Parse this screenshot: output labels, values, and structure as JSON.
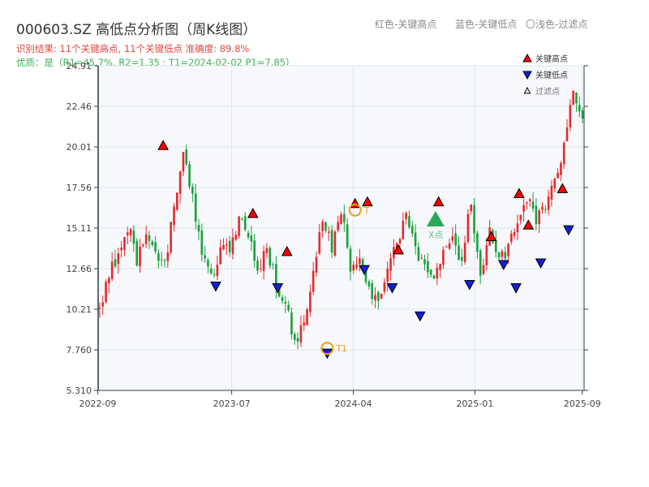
{
  "header": {
    "title": "000603.SZ 高低点分析图（周K线图）",
    "result_line": "识别结果: 11个关键高点, 11个关键低点  准确度: 89.8%",
    "quality_line": "优质：是（R1=45.7%, R2=1.35 ; T1=2024-02-02 P1=7.85）",
    "hint_red": "红色-关键高点",
    "hint_blue": "蓝色-关键低点",
    "hint_light": "〇浅色-过滤点"
  },
  "colors": {
    "up": "#e8282d",
    "down": "#1aa03c",
    "high_marker": "#ff0000",
    "low_marker": "#1020d8",
    "big_marker": "#2aa85a",
    "ring": "#f39c12",
    "plot_bg": "#f6f8fb",
    "grid": "#e2e6ea",
    "axis": "#2f3e50"
  },
  "chart_data": {
    "type": "candlestick",
    "title": "000603.SZ 高低点分析图（周K线图）",
    "x_range": [
      "2022-09-02",
      "2025-09-05"
    ],
    "ylim": [
      5.31,
      24.91
    ],
    "y_ticks": [
      "5.310",
      "7.760",
      "10.21",
      "12.66",
      "15.11",
      "17.56",
      "20.01",
      "22.46",
      "24.91"
    ],
    "x_ticks": [
      {
        "label": "2022-09",
        "date": "2022-09-01"
      },
      {
        "label": "2023-07",
        "date": "2023-07-01"
      },
      {
        "label": "2024-04",
        "date": "2024-04-01"
      },
      {
        "label": "2025-01",
        "date": "2025-01-01"
      },
      {
        "label": "2025-09",
        "date": "2025-09-01"
      }
    ],
    "legend": {
      "placement": "top-right",
      "entries": [
        {
          "label": "关键高点",
          "symbol": "up-triangle",
          "color": "#ff0000"
        },
        {
          "label": "关键低点",
          "symbol": "down-triangle",
          "color": "#1020d8"
        },
        {
          "label": "过滤点",
          "symbol": "small-up-triangle",
          "color": "#ffffff"
        }
      ]
    },
    "key_points": [
      {
        "value": 10.0
      },
      {
        "value": 12.4
      },
      {
        "value": 13.2
      },
      {
        "value": 15.3
      },
      {
        "value": 13.3
      },
      {
        "value": 14.6
      },
      {
        "value": 13.5
      },
      {
        "value": 12.7
      },
      {
        "value": 16.4
      },
      {
        "value": 19.6
      },
      {
        "value": 17.0
      },
      {
        "value": 13.2
      },
      {
        "value": 12.2
      },
      {
        "value": 13.6
      },
      {
        "value": 14.0
      },
      {
        "value": 15.7
      },
      {
        "value": 14.6
      },
      {
        "value": 12.6
      },
      {
        "value": 13.8
      },
      {
        "value": 11.8
      },
      {
        "value": 10.6
      },
      {
        "value": 8.2
      },
      {
        "value": 9.3
      },
      {
        "value": 12.1
      },
      {
        "value": 15.9
      },
      {
        "value": 14.0
      },
      {
        "value": 16.3
      },
      {
        "value": 12.9
      },
      {
        "value": 13.5
      },
      {
        "value": 11.6
      },
      {
        "value": 10.3
      },
      {
        "value": 12.4
      },
      {
        "value": 14.1
      },
      {
        "value": 16.4
      },
      {
        "value": 13.6
      },
      {
        "value": 12.7
      },
      {
        "value": 12.0
      },
      {
        "value": 13.5
      },
      {
        "value": 14.4
      },
      {
        "value": 13.2
      },
      {
        "value": 16.9
      },
      {
        "value": 11.8
      },
      {
        "value": 15.0
      },
      {
        "value": 13.3
      },
      {
        "value": 13.8
      },
      {
        "value": 15.5
      },
      {
        "value": 17.0
      },
      {
        "value": 15.5
      },
      {
        "value": 16.2
      },
      {
        "value": 18.2
      },
      {
        "value": 20.0
      },
      {
        "value": 23.2
      },
      {
        "value": 21.8
      }
    ],
    "key_highs": [
      {
        "date": "2023-01-27",
        "price": 19.8
      },
      {
        "date": "2023-08-18",
        "price": 15.7
      },
      {
        "date": "2023-11-03",
        "price": 13.4
      },
      {
        "date": "2024-04-05",
        "price": 16.3
      },
      {
        "date": "2024-05-03",
        "price": 16.4
      },
      {
        "date": "2024-07-12",
        "price": 13.5
      },
      {
        "date": "2024-10-11",
        "price": 16.4
      },
      {
        "date": "2025-02-07",
        "price": 14.3
      },
      {
        "date": "2025-04-11",
        "price": 16.9
      },
      {
        "date": "2025-05-02",
        "price": 15.0
      },
      {
        "date": "2025-07-18",
        "price": 17.2
      }
    ],
    "key_lows": [
      {
        "date": "2023-05-26",
        "price": 11.9
      },
      {
        "date": "2023-10-13",
        "price": 11.8
      },
      {
        "date": "2024-02-02",
        "price": 7.85
      },
      {
        "date": "2024-04-26",
        "price": 12.9
      },
      {
        "date": "2024-06-28",
        "price": 11.8
      },
      {
        "date": "2024-08-30",
        "price": 10.1
      },
      {
        "date": "2024-12-20",
        "price": 12.0
      },
      {
        "date": "2025-03-07",
        "price": 13.2
      },
      {
        "date": "2025-04-04",
        "price": 11.8
      },
      {
        "date": "2025-05-30",
        "price": 13.3
      },
      {
        "date": "2025-08-01",
        "price": 15.3
      }
    ],
    "marked_points": [
      {
        "label": "T1",
        "date": "2024-02-02",
        "price": 7.85
      },
      {
        "label": "T",
        "date": "2024-04-05",
        "price": 16.2
      }
    ],
    "big_marker": {
      "label": "X点",
      "date": "2024-10-04",
      "price": 15.6
    }
  }
}
